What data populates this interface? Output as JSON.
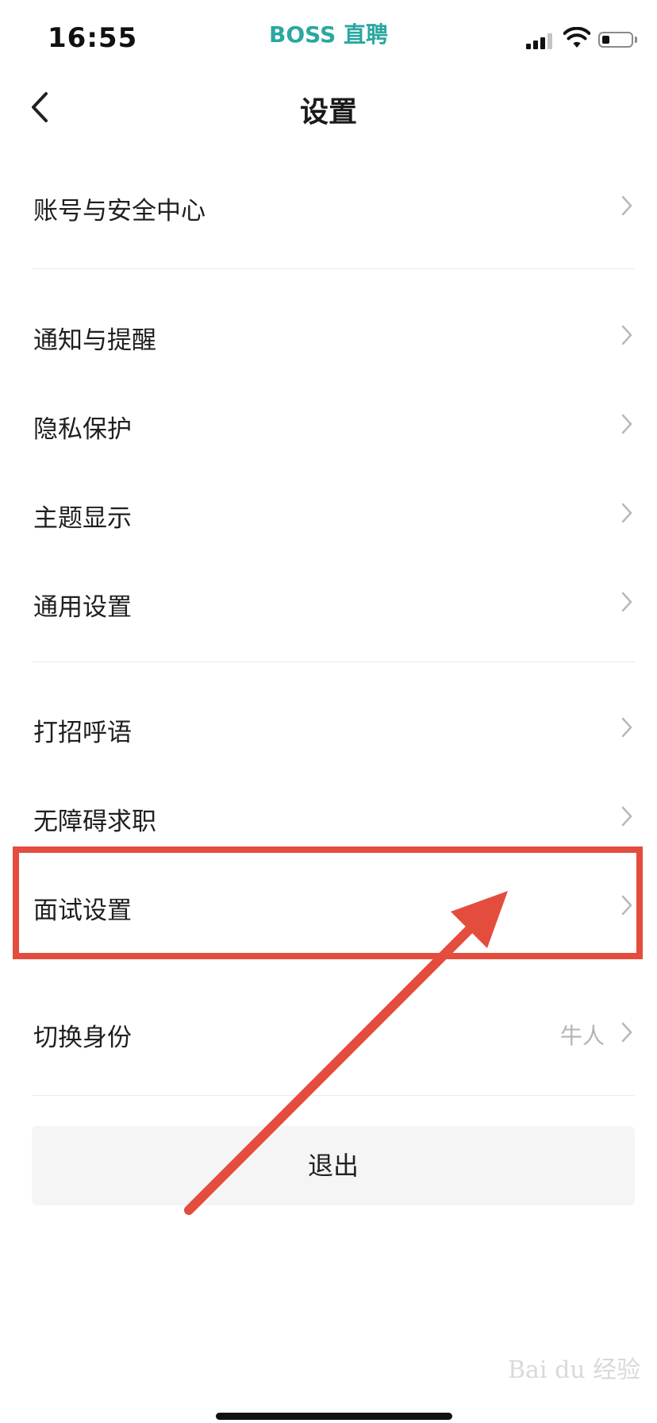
{
  "status_bar": {
    "time": "16:55",
    "app_brand": "BOSS 直聘"
  },
  "nav": {
    "title": "设置",
    "back_icon": "chevron-left-icon"
  },
  "groups": [
    {
      "items": [
        {
          "label": "账号与安全中心"
        }
      ]
    },
    {
      "items": [
        {
          "label": "通知与提醒"
        },
        {
          "label": "隐私保护"
        },
        {
          "label": "主题显示"
        },
        {
          "label": "通用设置"
        }
      ]
    },
    {
      "items": [
        {
          "label": "打招呼语"
        },
        {
          "label": "无障碍求职"
        },
        {
          "label": "面试设置"
        }
      ]
    },
    {
      "items": [
        {
          "label": "切换身份",
          "value": "牛人"
        }
      ]
    }
  ],
  "logout_label": "退出",
  "watermark": "Bai du 经验",
  "colors": {
    "brand": "#2aa7a0",
    "annotation": "#e44c3e",
    "chevron": "#b8b8b8",
    "divider": "#ebebeb"
  }
}
